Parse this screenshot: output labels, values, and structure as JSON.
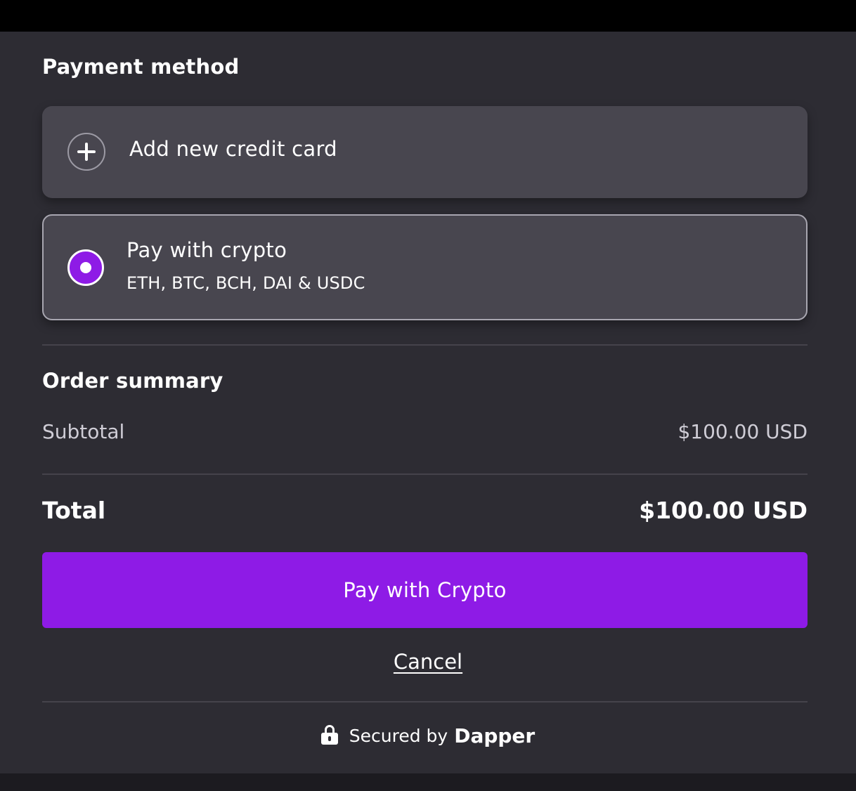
{
  "payment": {
    "title": "Payment method",
    "add_card_label": "Add new credit card",
    "crypto_option": {
      "title": "Pay with crypto",
      "subtitle": "ETH, BTC, BCH, DAI & USDC",
      "selected": true
    }
  },
  "order": {
    "title": "Order summary",
    "subtotal_label": "Subtotal",
    "subtotal_value": "$100.00 USD",
    "total_label": "Total",
    "total_value": "$100.00 USD"
  },
  "actions": {
    "pay_button_label": "Pay with Crypto",
    "cancel_label": "Cancel"
  },
  "footer": {
    "secured_text": "Secured by",
    "brand": "Dapper"
  },
  "icons": {
    "add": "plus-circle-icon",
    "radio": "radio-selected-icon",
    "lock": "lock-icon"
  },
  "colors": {
    "accent": "#8e1be6",
    "background": "#2d2c33",
    "card": "#48464f"
  }
}
